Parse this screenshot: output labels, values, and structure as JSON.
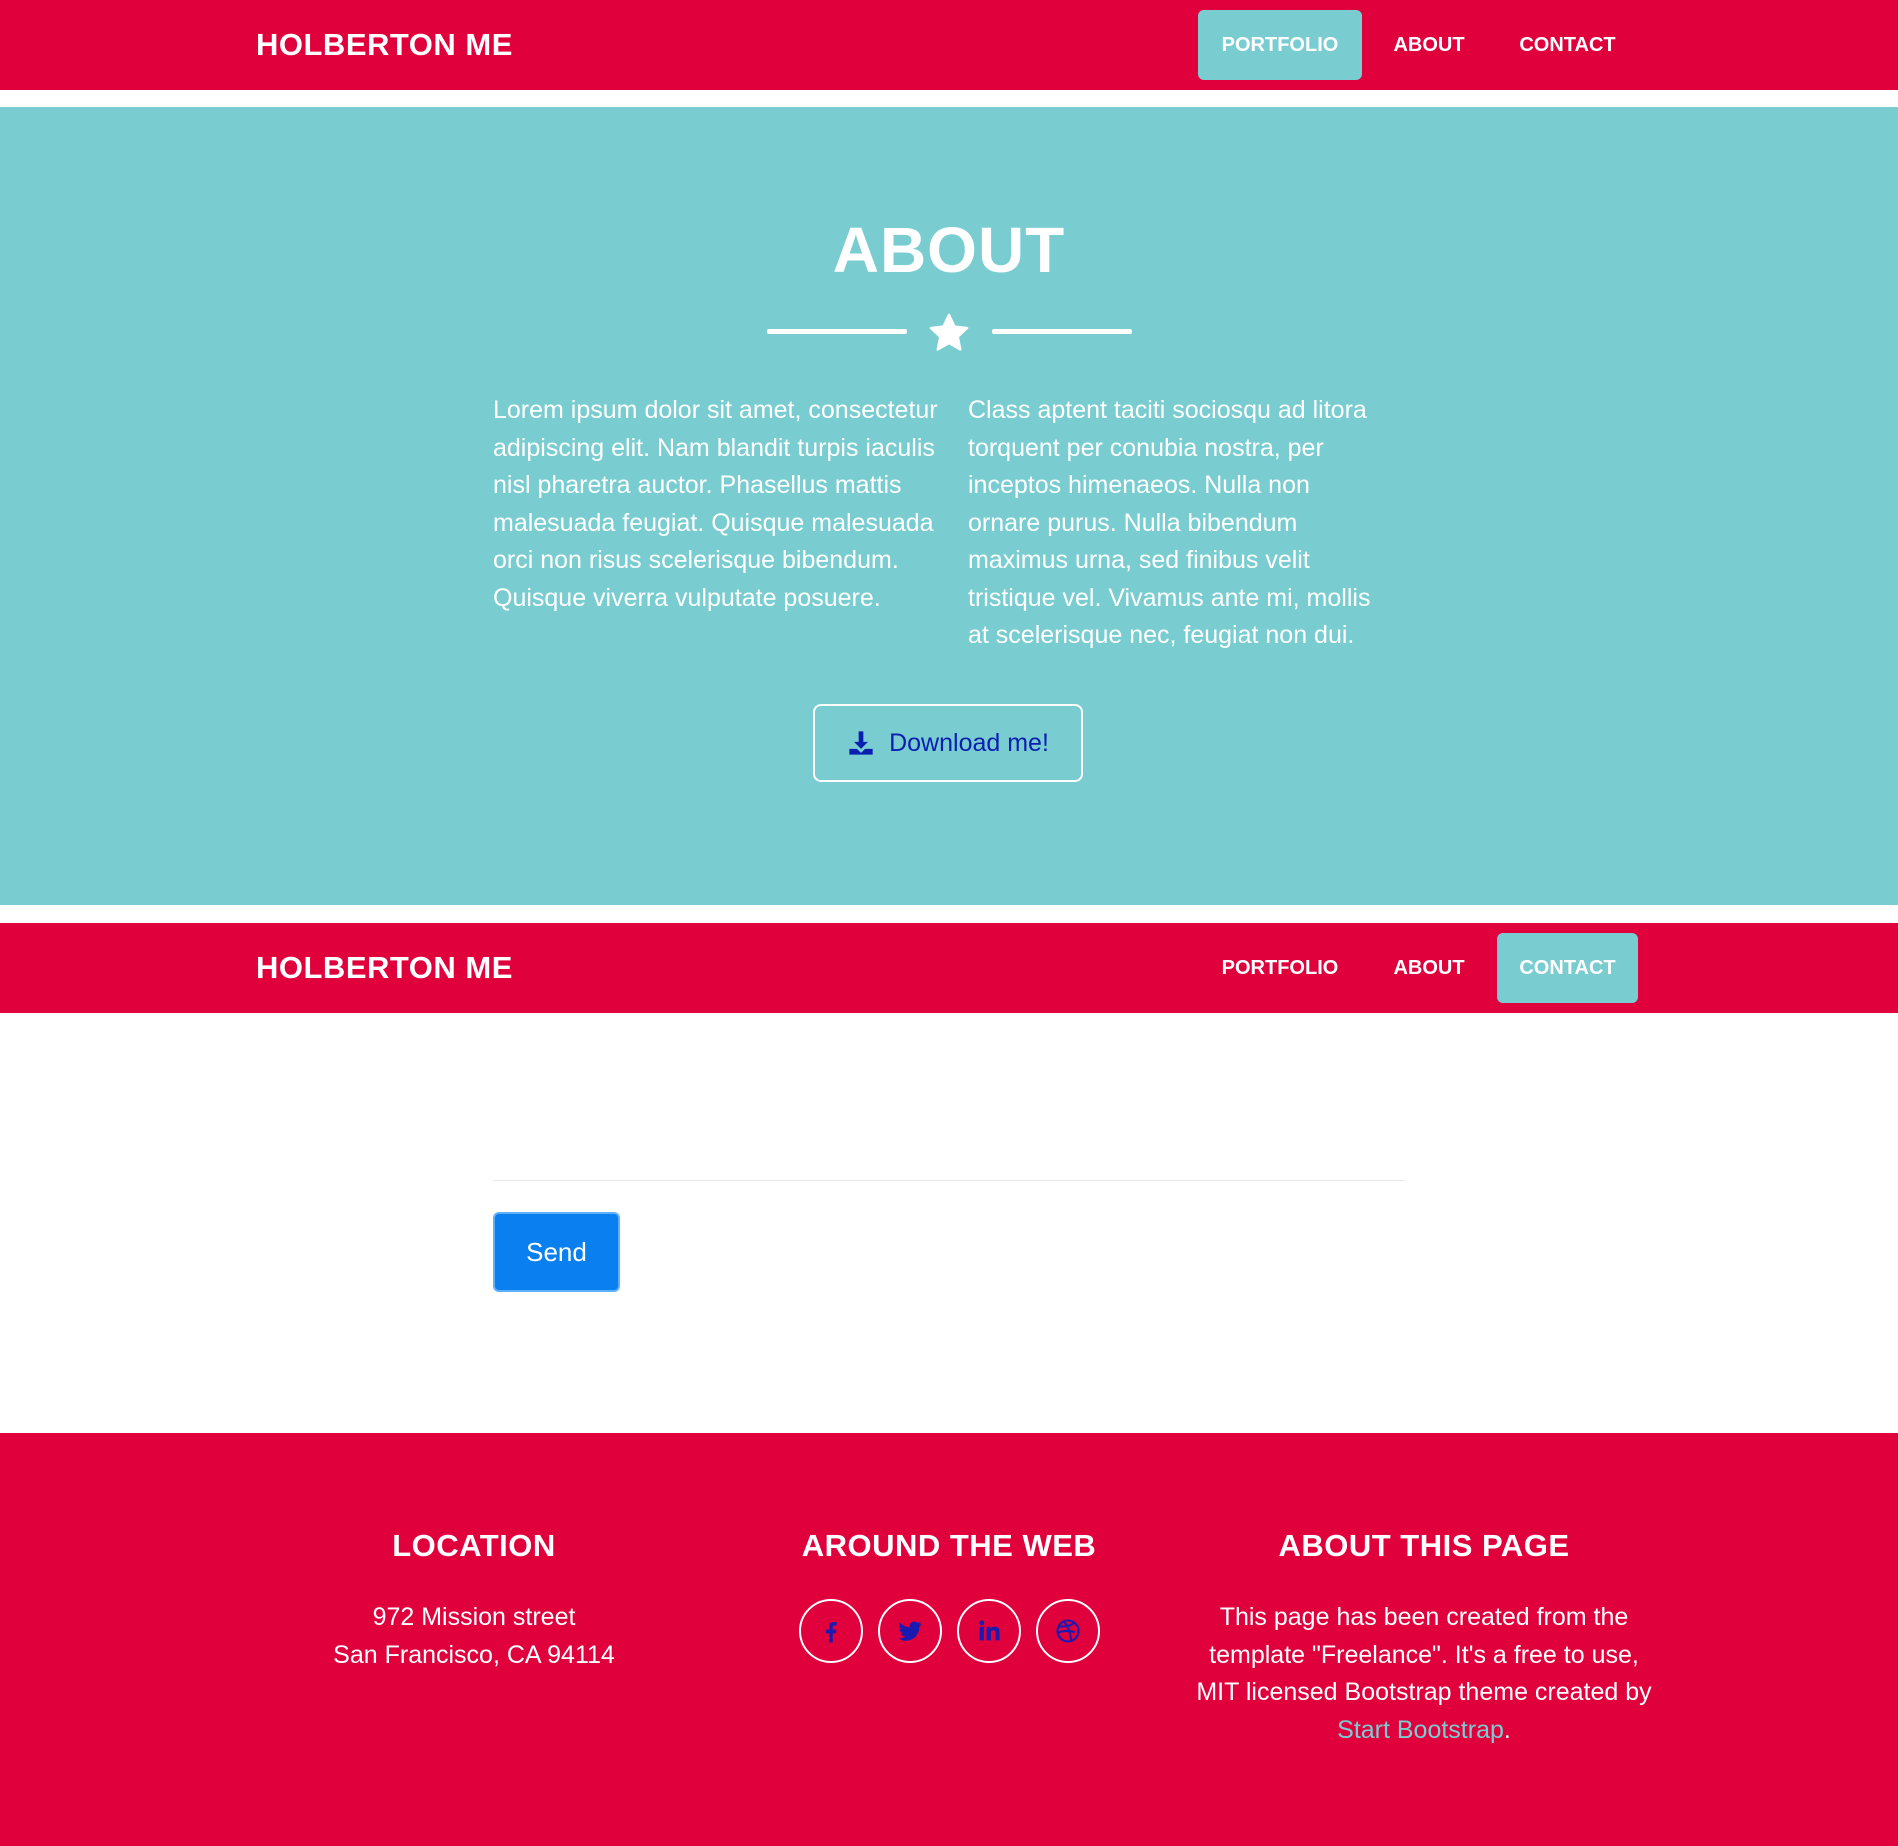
{
  "nav": {
    "brand": "HOLBERTON ME",
    "links": [
      "PORTFOLIO",
      "ABOUT",
      "CONTACT"
    ]
  },
  "about": {
    "title": "ABOUT",
    "paragraph_left": "Lorem ipsum dolor sit amet, consectetur adipiscing elit. Nam blandit turpis iaculis nisl pharetra auctor. Phasellus mattis malesuada feugiat. Quisque malesuada orci non risus scelerisque bibendum. Quisque viverra vulputate posuere.",
    "paragraph_right": "Class aptent taciti sociosqu ad litora torquent per conubia nostra, per inceptos himenaeos. Nulla non ornare purus. Nulla bibendum maximus urna, sed finibus velit tristique vel. Vivamus ante mi, mollis at scelerisque nec, feugiat non dui.",
    "download_label": "Download me!"
  },
  "contact": {
    "send_label": "Send"
  },
  "footer": {
    "location_title": "LOCATION",
    "address_line1": "972 Mission street",
    "address_line2": "San Francisco, CA 94114",
    "web_title": "AROUND THE WEB",
    "social_icons": [
      "facebook-icon",
      "twitter-icon",
      "linkedin-icon",
      "dribbble-icon"
    ],
    "about_title": "ABOUT THIS PAGE",
    "about_text": "This page has been created from the template \"Freelance\". It's a free to use, MIT licensed Bootstrap theme created by ",
    "about_link": "Start Bootstrap",
    "about_end": "."
  },
  "colors": {
    "primary_red": "#e0003c",
    "teal": "#79cdd1",
    "send_blue": "#0a7ff0",
    "icon_blue": "#1a1ab0"
  }
}
